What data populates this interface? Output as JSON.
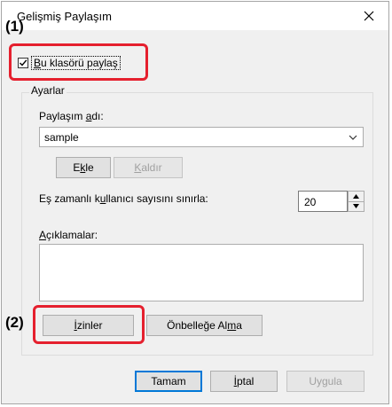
{
  "dialog": {
    "title": "Gelişmiş Paylaşım",
    "close_icon": "close-icon"
  },
  "annotations": {
    "one": "(1)",
    "two": "(2)"
  },
  "share_checkbox": {
    "label_underlined": "B",
    "label_rest": "u klasörü paylaş",
    "checked": true
  },
  "settings": {
    "group_label": "Ayarlar",
    "share_name_label_pre": "Paylaşım ",
    "share_name_label_u": "a",
    "share_name_label_post": "dı:",
    "share_name_value": "sample",
    "add_pre": "E",
    "add_u": "k",
    "add_post": "le",
    "remove_u": "K",
    "remove_post": "aldır",
    "limit_pre": "Eş zamanlı k",
    "limit_u": "u",
    "limit_post": "llanıcı sayısını sınırla:",
    "limit_value": "20",
    "comments_u": "A",
    "comments_post": "çıklamalar:",
    "comments_value": "",
    "permissions_u": "İ",
    "permissions_post": "zinler",
    "caching_pre": "Önbelleğe Al",
    "caching_u": "m",
    "caching_post": "a"
  },
  "footer": {
    "ok": "Tamam",
    "cancel_u": "İ",
    "cancel_post": "ptal",
    "apply": "Uygula"
  },
  "colors": {
    "highlight": "#e5202e",
    "default_button_border": "#0078d7"
  }
}
